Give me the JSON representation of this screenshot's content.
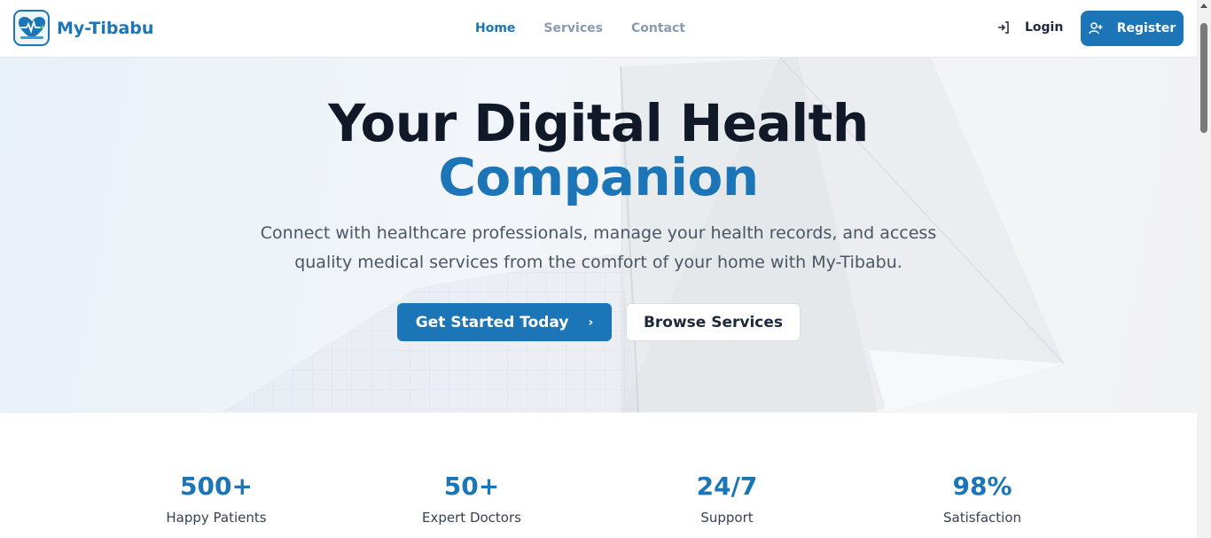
{
  "brand": {
    "name": "My-Tibabu",
    "logo_icon": "heart-pulse-icon"
  },
  "nav": {
    "items": [
      {
        "label": "Home",
        "active": true
      },
      {
        "label": "Services",
        "active": false
      },
      {
        "label": "Contact",
        "active": false
      }
    ]
  },
  "auth": {
    "login_label": "Login",
    "register_label": "Register"
  },
  "hero": {
    "title_line1": "Your Digital Health",
    "title_line2": "Companion",
    "description": "Connect with healthcare professionals, manage your health records, and access quality medical services from the comfort of your home with My-Tibabu.",
    "primary_cta": "Get Started Today",
    "secondary_cta": "Browse Services"
  },
  "stats": [
    {
      "value": "500+",
      "label": "Happy Patients"
    },
    {
      "value": "50+",
      "label": "Expert Doctors"
    },
    {
      "value": "24/7",
      "label": "Support"
    },
    {
      "value": "98%",
      "label": "Satisfaction"
    }
  ],
  "colors": {
    "brand": "#1b75b7",
    "heading": "#111827",
    "muted_nav": "#8a9bb0"
  }
}
